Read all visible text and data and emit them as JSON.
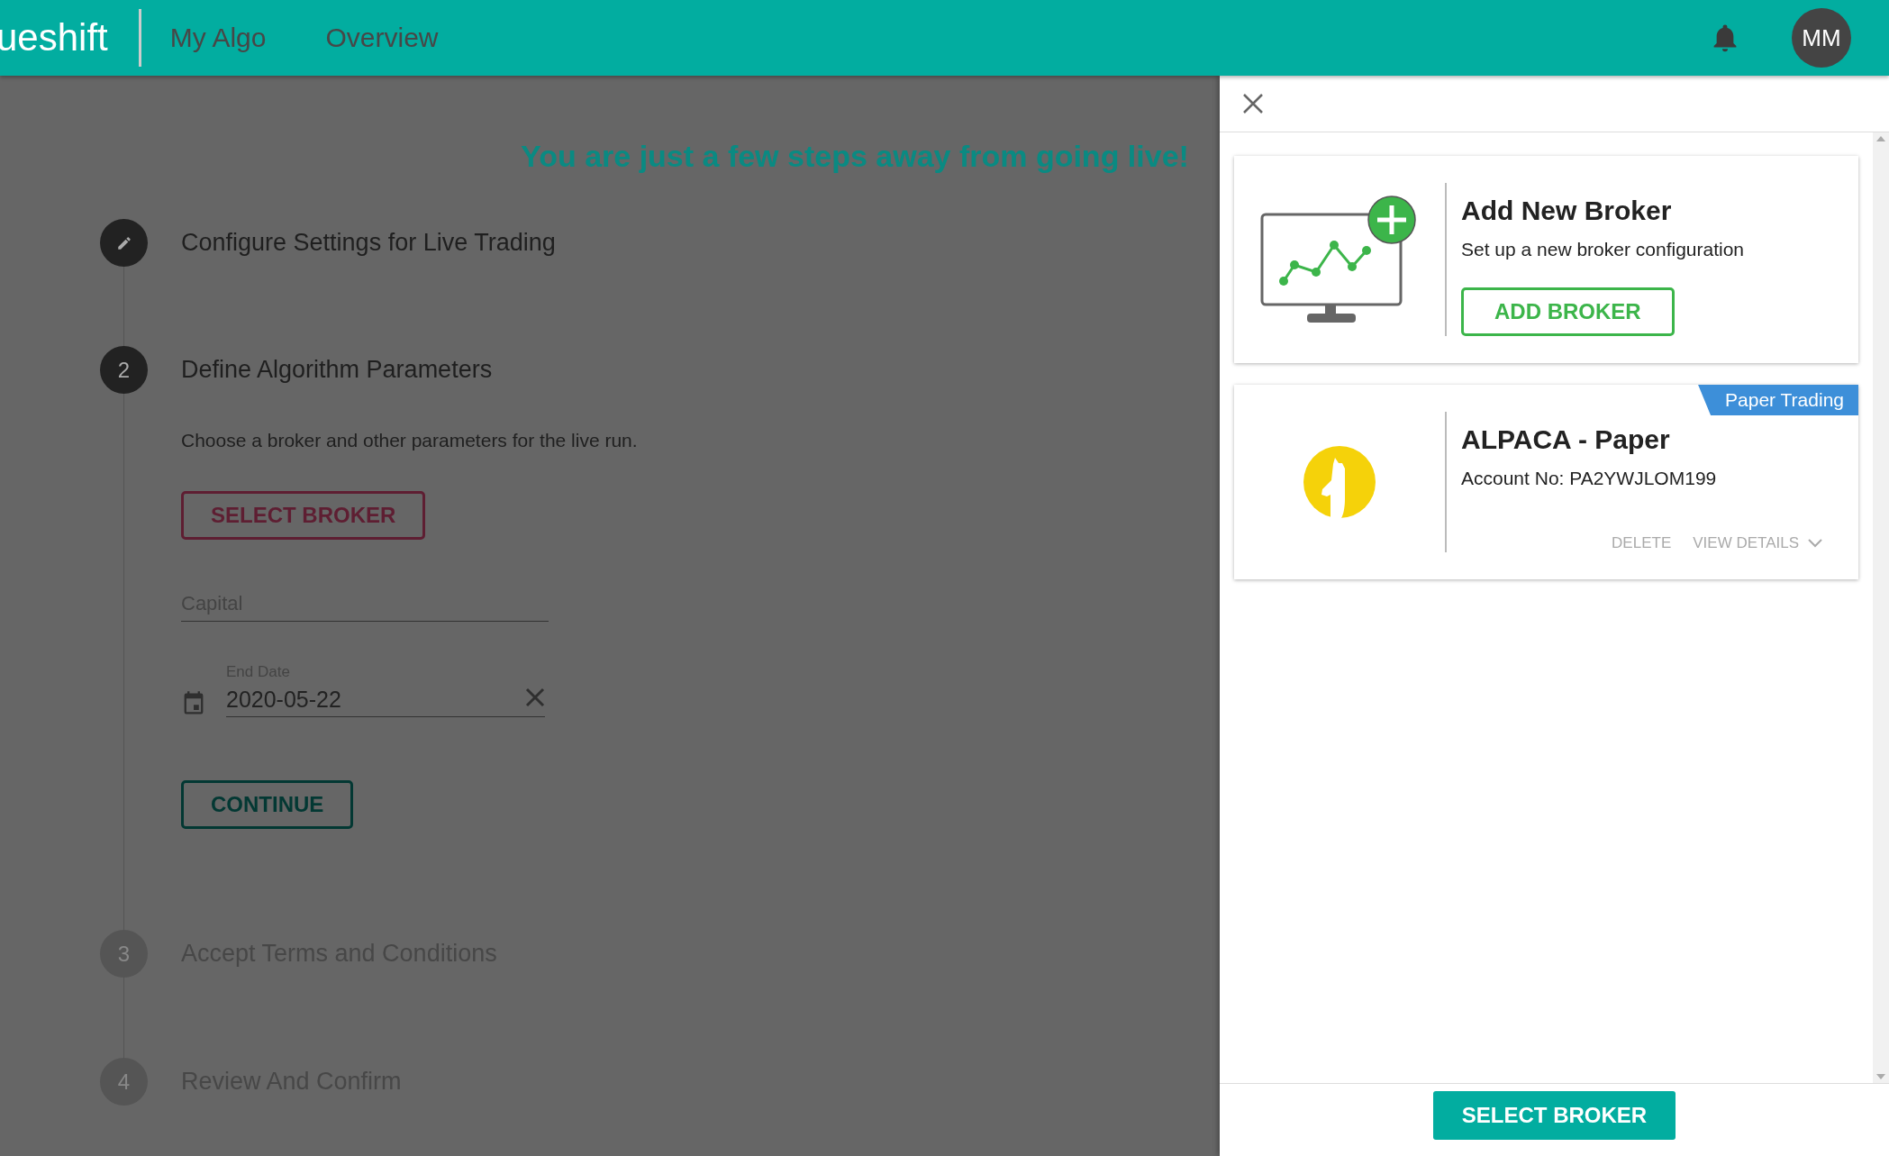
{
  "header": {
    "logo": "ueshift",
    "nav": [
      {
        "label": "My Algo"
      },
      {
        "label": "Overview"
      }
    ],
    "avatar": "MM"
  },
  "main": {
    "heading": "You are just a few steps away from going live!",
    "steps": [
      {
        "kind": "edit",
        "disabled": false,
        "title": "Configure Settings for Live Trading"
      },
      {
        "kind": "number",
        "disabled": false,
        "number": "2",
        "title": "Define Algorithm Parameters"
      },
      {
        "kind": "number",
        "disabled": true,
        "number": "3",
        "title": "Accept Terms and Conditions"
      },
      {
        "kind": "number",
        "disabled": true,
        "number": "4",
        "title": "Review And Confirm"
      }
    ],
    "form": {
      "description": "Choose a broker and other parameters for the live run.",
      "select_button": "SELECT BROKER",
      "capital": {
        "placeholder": "Capital"
      },
      "end_date": {
        "label": "End Date",
        "value": "2020-05-22"
      },
      "continue_button": "CONTINUE"
    }
  },
  "drawer": {
    "add_card": {
      "title": "Add New Broker",
      "description": "Set up a new broker configuration",
      "button": "ADD BROKER"
    },
    "brokers": [
      {
        "name": "ALPACA - Paper",
        "account": "Account No: PA2YWJLOM199",
        "badge": "Paper Trading",
        "actions": [
          "DELETE",
          "VIEW DETAILS"
        ]
      }
    ],
    "footer_button": "SELECT BROKER"
  }
}
